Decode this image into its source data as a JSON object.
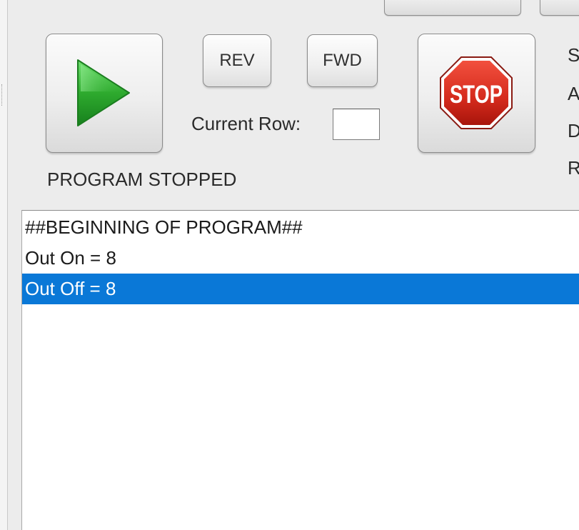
{
  "transport": {
    "play_icon": "play-triangle-icon",
    "rev_label": "REV",
    "fwd_label": "FWD",
    "stop_label": "STOP",
    "current_row_label": "Current Row:",
    "current_row_value": "",
    "status_text": "PROGRAM STOPPED"
  },
  "right_panel": {
    "letters": [
      "S",
      "A",
      "D",
      "R"
    ]
  },
  "program": {
    "lines": [
      {
        "text": "##BEGINNING OF PROGRAM##",
        "selected": false
      },
      {
        "text": "Out On = 8",
        "selected": false
      },
      {
        "text": "Out Off = 8",
        "selected": true
      }
    ]
  },
  "colors": {
    "selection": "#0a78d7",
    "play_green": "#2eaa2e",
    "stop_red": "#d42a1c"
  }
}
